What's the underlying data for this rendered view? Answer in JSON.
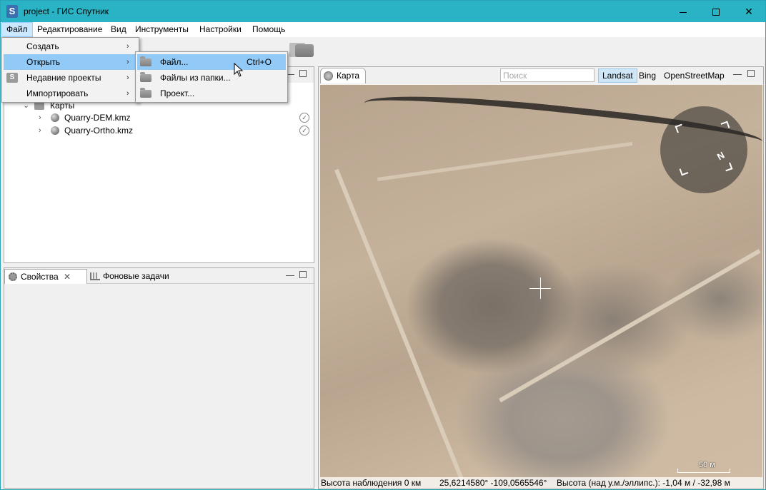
{
  "window": {
    "app_icon": "S",
    "title": "project - ГИС Спутник",
    "minimize_icon": "minimize-icon",
    "maximize_icon": "maximize-icon",
    "close_glyph": "✕"
  },
  "menubar": {
    "items": [
      {
        "label": "Файл",
        "active": true
      },
      {
        "label": "Редактирование"
      },
      {
        "label": "Вид"
      },
      {
        "label": "Инструменты"
      },
      {
        "label": "Настройки"
      },
      {
        "label": "Помощь"
      }
    ]
  },
  "file_menu": {
    "items": [
      {
        "label": "Создать",
        "arrow": "›"
      },
      {
        "label": "Открыть",
        "arrow": "›",
        "hover": true
      },
      {
        "label": "Недавние проекты",
        "arrow": "›",
        "icon": "S"
      },
      {
        "label": "Импортировать",
        "arrow": "›"
      }
    ]
  },
  "open_submenu": {
    "items": [
      {
        "label": "Файл...",
        "shortcut": "Ctrl+O",
        "icon": "folder-open-icon",
        "hover": true
      },
      {
        "label": "Файлы из папки...",
        "icon": "folder-icon"
      },
      {
        "label": "Проект...",
        "icon": "project-folder-icon"
      }
    ]
  },
  "project_tree": {
    "group_label": "Карты",
    "items": [
      {
        "label": "Quarry-DEM.kmz",
        "chevron": "›",
        "visibility_icon": "checkmark-circle-icon"
      },
      {
        "label": "Quarry-Ortho.kmz",
        "chevron": "›",
        "visibility_icon": "checkmark-circle-icon"
      }
    ],
    "group_chevron": "⌄"
  },
  "bottom_panel": {
    "tabs": [
      {
        "label": "Свойства",
        "close": "✕",
        "active": true
      },
      {
        "label": "Фоновые задачи"
      }
    ]
  },
  "map_panel": {
    "tab_label": "Карта",
    "search_placeholder": "Поиск",
    "layers": [
      {
        "label": "Landsat",
        "selected": true
      },
      {
        "label": "Bing"
      },
      {
        "label": "OpenStreetMap"
      }
    ],
    "compass_label": "N",
    "scale_label": "50 м",
    "status": {
      "altitude": "Высота наблюдения 0 км",
      "coordinates": "25,6214580° -109,0565546°",
      "elevation": "Высота (над у.м./эллипс.): -1,04 м / -32,98 м"
    }
  }
}
